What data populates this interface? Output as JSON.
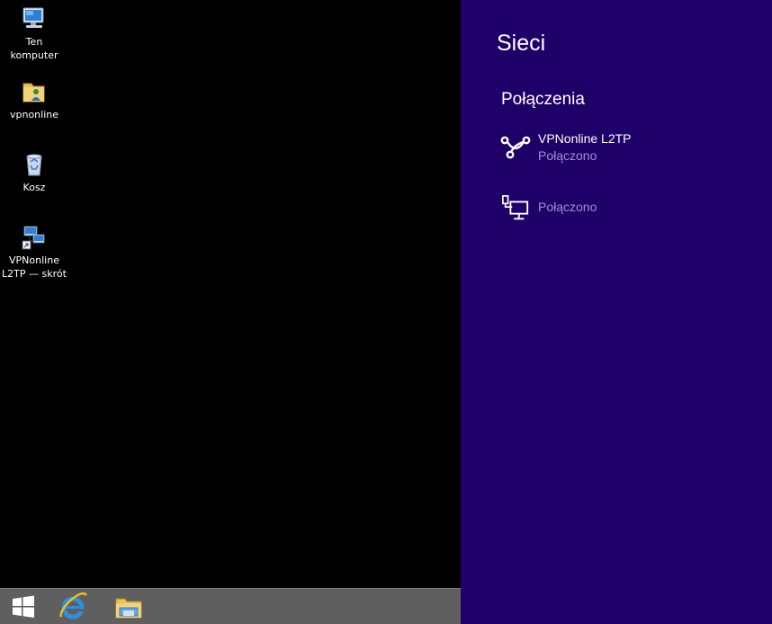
{
  "desktop": {
    "icons": [
      {
        "label": "Ten\nkomputer",
        "icon": "computer-icon"
      },
      {
        "label": "vpnonline",
        "icon": "user-folder-icon"
      },
      {
        "label": "Kosz",
        "icon": "recycle-bin-icon"
      },
      {
        "label": "VPNonline\nL2TP — skrót",
        "icon": "network-shortcut-icon"
      }
    ]
  },
  "taskbar": {
    "items": [
      {
        "name": "start-button",
        "icon": "windows-logo-icon"
      },
      {
        "name": "internet-explorer-button",
        "icon": "internet-explorer-icon"
      },
      {
        "name": "file-explorer-button",
        "icon": "file-explorer-icon"
      }
    ]
  },
  "charm": {
    "title": "Sieci",
    "section": "Połączenia",
    "connections": [
      {
        "name": "VPNonline L2TP",
        "status": "Połączono",
        "icon": "vpn-icon"
      },
      {
        "name": "",
        "status": "Połączono",
        "icon": "ethernet-icon"
      }
    ]
  },
  "colors": {
    "charm_background": "#1f0068",
    "status_text": "#a58fd6",
    "taskbar": "#5f5f5f",
    "desktop": "#000000"
  }
}
